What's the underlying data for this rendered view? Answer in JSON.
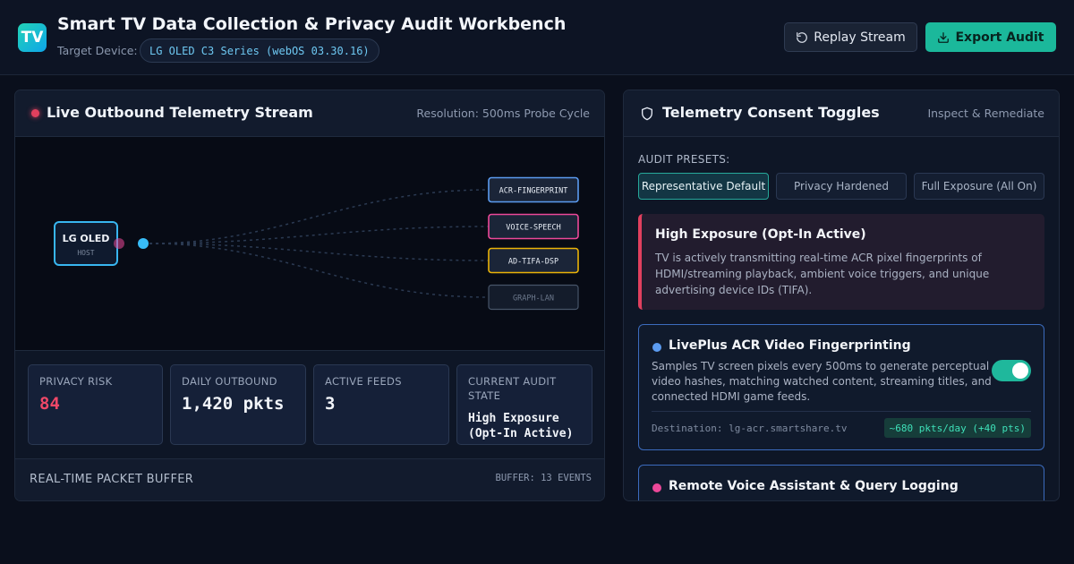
{
  "header": {
    "logo_text": "TV",
    "title": "Smart TV Data Collection & Privacy Audit Workbench",
    "target_label": "Target Device:",
    "device": "LG OLED C3 Series (webOS 03.30.16)",
    "replay_label": "Replay Stream",
    "export_label": "Export Audit",
    "accent_color": "#1bb89b"
  },
  "stream_panel": {
    "title": "Live Outbound Telemetry Stream",
    "resolution": "Resolution: 500ms Probe Cycle",
    "host": {
      "label": "LG OLED",
      "sub": "HOST"
    },
    "feeds": [
      {
        "label": "ACR-FINGERPRINT",
        "color": "#5b9bf0",
        "active": true
      },
      {
        "label": "VOICE-SPEECH",
        "color": "#ec4899",
        "active": true
      },
      {
        "label": "AD-TIFA-DSP",
        "color": "#eab308",
        "active": true
      },
      {
        "label": "GRAPH-LAN",
        "color": "#475569",
        "active": false
      }
    ],
    "stats": [
      {
        "label": "PRIVACY RISK",
        "value": "84"
      },
      {
        "label": "DAILY OUTBOUND",
        "value": "1,420 pkts"
      },
      {
        "label": "ACTIVE FEEDS",
        "value": "3"
      },
      {
        "label": "CURRENT AUDIT STATE",
        "value": "High Exposure (Opt-In Active)"
      }
    ],
    "buffer_title": "REAL-TIME PACKET BUFFER",
    "buffer_count": "BUFFER: 13 EVENTS"
  },
  "consent_panel": {
    "title": "Telemetry Consent Toggles",
    "meta": "Inspect & Remediate",
    "presets_label": "AUDIT PRESETS:",
    "presets": [
      {
        "label": "Representative Default",
        "active": true
      },
      {
        "label": "Privacy Hardened",
        "active": false
      },
      {
        "label": "Full Exposure (All On)",
        "active": false
      }
    ],
    "alert": {
      "title": "High Exposure (Opt-In Active)",
      "text": "TV is actively transmitting real-time ACR pixel fingerprints of HDMI/streaming playback, ambient voice triggers, and unique advertising device IDs (TIFA)."
    },
    "toggles": [
      {
        "title": "LivePlus ACR Video Fingerprinting",
        "desc": "Samples TV screen pixels every 500ms to generate perceptual video hashes, matching watched content, streaming titles, and connected HDMI game feeds.",
        "destination": "Destination: lg-acr.smartshare.tv",
        "rate": "~680 pkts/day (+40 pts)",
        "enabled": true
      },
      {
        "title": "Remote Voice Assistant & Query Logging",
        "enabled": true
      }
    ]
  }
}
